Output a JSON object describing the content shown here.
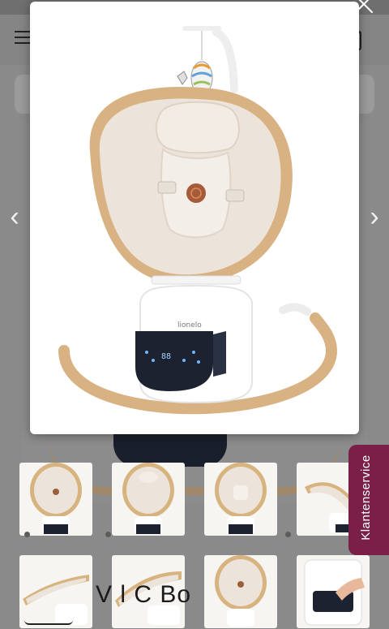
{
  "header": {
    "menu_icon": "hamburger-icon",
    "cart_icon": "cart-icon"
  },
  "lightbox": {
    "close_icon": "close-icon",
    "prev_arrow": "‹",
    "next_arrow": "›",
    "brand_on_device": "lionelo",
    "display_digits": "88"
  },
  "thumbnails": [
    {
      "alt": "front-view"
    },
    {
      "alt": "front-view-headrest"
    },
    {
      "alt": "front-view-harness"
    },
    {
      "alt": "side-view-reclined"
    },
    {
      "alt": "side-view-1"
    },
    {
      "alt": "side-view-2"
    },
    {
      "alt": "front-view-3"
    },
    {
      "alt": "control-panel-hand"
    }
  ],
  "product_title_fragment": "V   l C   Bo",
  "feedback_tab": {
    "label": "Klantenservice"
  },
  "colors": {
    "accent": "#7a1f48",
    "frame_wood": "#d9b586",
    "seat_fabric": "#ece4da",
    "control_panel": "#1c2230"
  }
}
